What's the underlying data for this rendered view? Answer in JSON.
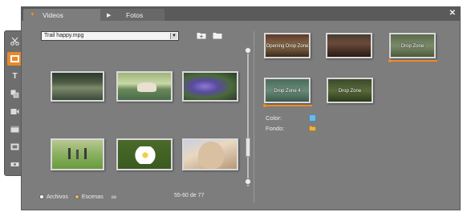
{
  "toolbar": {
    "tools": [
      "scissors-icon",
      "album-icon",
      "title-icon",
      "transitions-icon",
      "sound-icon",
      "menu-icon",
      "frame-icon",
      "volume-icon"
    ],
    "title_tool_glyph": "T"
  },
  "tabs": {
    "videos": "Videos",
    "fotos": "Fotos"
  },
  "file_select": {
    "value": "Trail happy.mpg"
  },
  "status": {
    "archivos": "Archivos",
    "escenas": "Escenas",
    "count": "55-60 de 77"
  },
  "drop_zones": [
    {
      "label": "Opening Drop Zone"
    },
    {
      "label": ""
    },
    {
      "label": "Drop Zone"
    },
    {
      "label": "Drop Zone 4"
    },
    {
      "label": "Drop Zone"
    }
  ],
  "properties": {
    "color_label": "Color:",
    "fondo_label": "Fondo:",
    "color_value": "#6fb8e8"
  },
  "colors": {
    "accent": "#f08a24",
    "panel_bg": "#7d7d7d"
  }
}
